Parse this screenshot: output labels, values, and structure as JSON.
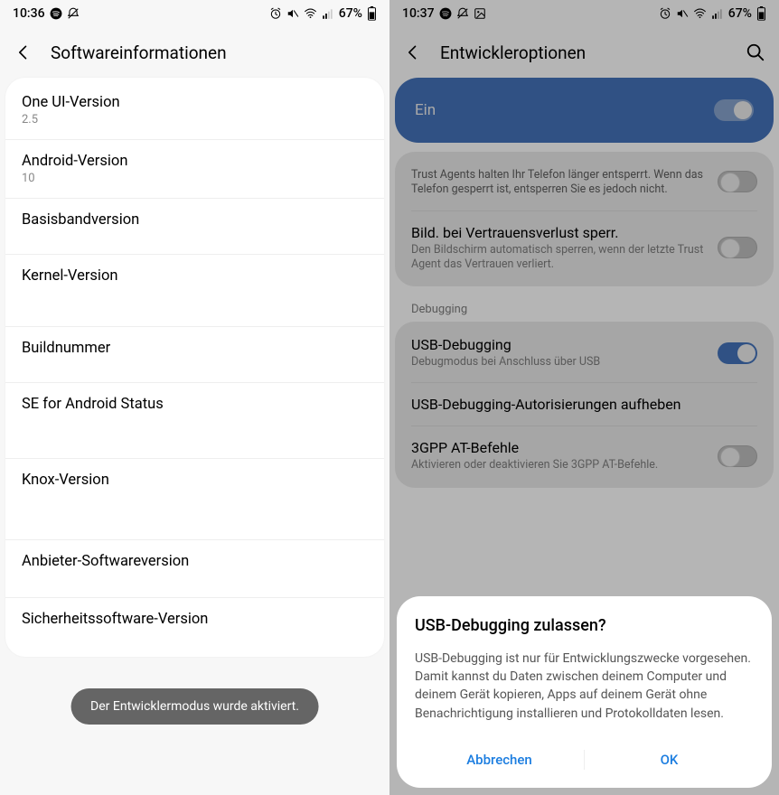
{
  "left": {
    "status": {
      "time": "10:36",
      "battery": "67%"
    },
    "header": {
      "title": "Softwareinformationen"
    },
    "items": [
      {
        "title": "One UI-Version",
        "sub": "2.5"
      },
      {
        "title": "Android-Version",
        "sub": "10"
      },
      {
        "title": "Basisbandversion",
        "sub": ""
      },
      {
        "title": "Kernel-Version",
        "sub": ""
      },
      {
        "title": "Buildnummer",
        "sub": ""
      },
      {
        "title": "SE for Android Status",
        "sub": ""
      },
      {
        "title": "Knox-Version",
        "sub": ""
      },
      {
        "title": "Anbieter-Softwareversion",
        "sub": ""
      },
      {
        "title": "Sicherheitssoftware-Version",
        "sub": ""
      }
    ],
    "toast": "Der Entwicklermodus wurde aktiviert."
  },
  "right": {
    "status": {
      "time": "10:37",
      "battery": "67%"
    },
    "header": {
      "title": "Entwickleroptionen"
    },
    "mainToggle": {
      "label": "Ein"
    },
    "trustAgents": {
      "desc": "Trust Agents halten Ihr Telefon länger entsperrt. Wenn das Telefon gesperrt ist, entsperren Sie es jedoch nicht."
    },
    "lockOnTrustLoss": {
      "title": "Bild. bei Vertrauensverlust sperr.",
      "sub": "Den Bildschirm automatisch sperren, wenn der letzte Trust Agent das Vertrauen verliert."
    },
    "sectionDebugging": "Debugging",
    "usbDebugging": {
      "title": "USB-Debugging",
      "sub": "Debugmodus bei Anschluss über USB"
    },
    "revokeAuth": {
      "title": "USB-Debugging-Autorisierungen aufheben"
    },
    "atCommands": {
      "title": "3GPP AT-Befehle",
      "sub": "Aktivieren oder deaktivieren Sie 3GPP AT-Befehle."
    },
    "dialog": {
      "title": "USB-Debugging zulassen?",
      "body": "USB-Debugging ist nur für Entwicklungszwecke vorgesehen. Damit kannst du Daten zwischen deinem Computer und deinem Gerät kopieren, Apps auf deinem Gerät ohne Benachrichtigung installieren und Protokolldaten lesen.",
      "cancel": "Abbrechen",
      "ok": "OK"
    }
  }
}
